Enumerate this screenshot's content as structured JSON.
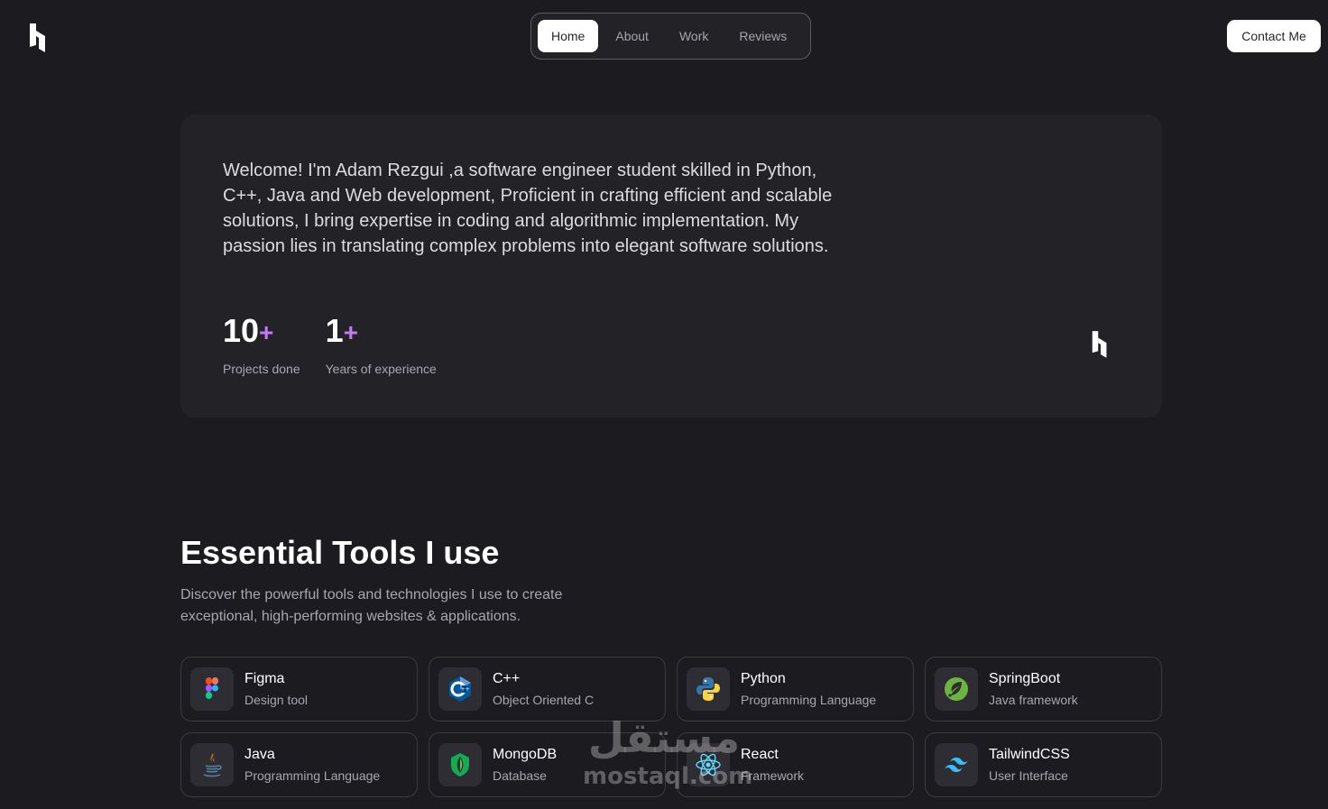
{
  "header": {
    "logo_icon": "brand-logo-icon",
    "nav": [
      {
        "label": "Home",
        "active": true
      },
      {
        "label": "About",
        "active": false
      },
      {
        "label": "Work",
        "active": false
      },
      {
        "label": "Reviews",
        "active": false
      }
    ],
    "contact_label": "Contact Me"
  },
  "hero": {
    "intro": "Welcome! I'm Adam Rezgui ,a software engineer student skilled in Python, C++, Java and Web development, Proficient in crafting efficient and scalable solutions, I bring expertise in coding and algorithmic implementation. My passion lies in translating complex problems into elegant software solutions.",
    "stats": [
      {
        "value": "10",
        "suffix": "+",
        "label": "Projects done"
      },
      {
        "value": "1",
        "suffix": "+",
        "label": "Years of experience"
      }
    ],
    "accent_color": "#c17bf2"
  },
  "tools": {
    "title": "Essential Tools I use",
    "description": "Discover the powerful tools and technologies I use to create exceptional, high-performing websites & applications.",
    "items": [
      {
        "name": "Figma",
        "sub": "Design tool",
        "icon": "figma-icon"
      },
      {
        "name": "C++",
        "sub": "Object Oriented C",
        "icon": "cpp-icon"
      },
      {
        "name": "Python",
        "sub": "Programming Language",
        "icon": "python-icon"
      },
      {
        "name": "SpringBoot",
        "sub": "Java framework",
        "icon": "springboot-icon"
      },
      {
        "name": "Java",
        "sub": "Programming Language",
        "icon": "java-icon"
      },
      {
        "name": "MongoDB",
        "sub": "Database",
        "icon": "mongodb-icon"
      },
      {
        "name": "React",
        "sub": "Framework",
        "icon": "react-icon"
      },
      {
        "name": "TailwindCSS",
        "sub": "User Interface",
        "icon": "tailwind-icon"
      }
    ]
  },
  "watermark": {
    "logo_text": "مستقل",
    "text": "mostaql.com"
  }
}
